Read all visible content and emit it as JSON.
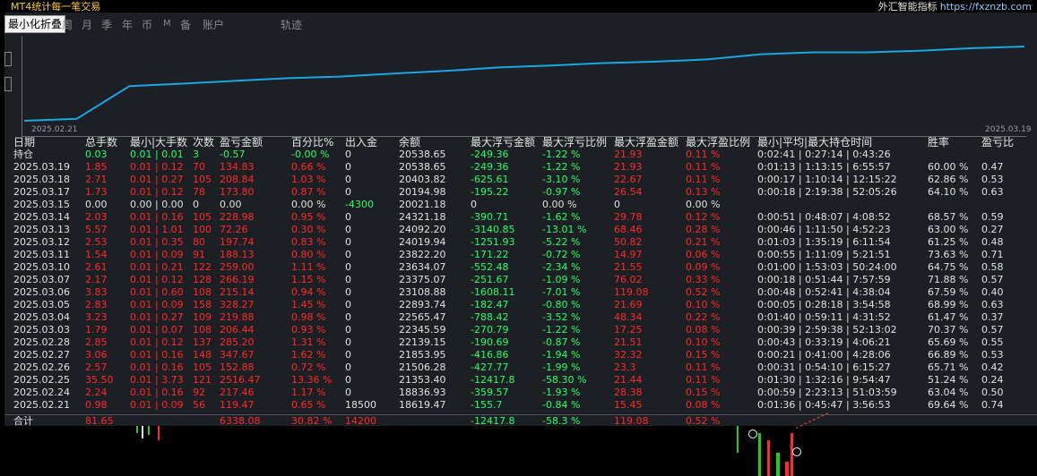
{
  "header": {
    "app_title": "MT4统计每一笔交易",
    "brand_text": "外汇智能指标",
    "brand_url": "https://fxznzb.com"
  },
  "tabs": {
    "minimize_label": "最小化折叠",
    "items": [
      "周",
      "月",
      "季",
      "年",
      "币",
      "M",
      "备",
      "账户",
      "轨迹"
    ]
  },
  "chart": {
    "start_date": "2025.02.21",
    "end_date": "2025.03.19",
    "line_color": "#1aa6e6"
  },
  "chart_data": {
    "type": "line",
    "x": [
      "2025.02.21",
      "2025.02.24",
      "2025.02.25",
      "2025.02.26",
      "2025.02.27",
      "2025.02.28",
      "2025.03.03",
      "2025.03.04",
      "2025.03.05",
      "2025.03.06",
      "2025.03.07",
      "2025.03.10",
      "2025.03.11",
      "2025.03.12",
      "2025.03.13",
      "2025.03.14",
      "2025.03.15",
      "2025.03.17",
      "2025.03.18",
      "2025.03.19"
    ],
    "values": [
      0.98,
      3.22,
      38.72,
      41.29,
      44.35,
      47.2,
      48.99,
      52.22,
      55.05,
      58.88,
      61.05,
      63.66,
      65.2,
      67.73,
      73.3,
      75.33,
      75.33,
      77.06,
      79.77,
      81.62
    ],
    "ylabel": "",
    "xlabel": ""
  },
  "table": {
    "headers": [
      "日期",
      "总手数",
      "最小|大手数",
      "次数",
      "盈亏金额",
      "百分比%",
      "出入金",
      "余额",
      "最大浮亏金额",
      "最大浮亏比例",
      "最大浮盈金额",
      "最大浮盈比例",
      "最小|平均|最大持仓时间",
      "胜率",
      "盈亏比"
    ],
    "holding": {
      "label": "持仓",
      "lots": "0.03",
      "minmax": "0.01 | 0.01",
      "count": "3",
      "pnl": "-0.57",
      "pct": "-0.00 %",
      "flow": "0",
      "balance": "20538.65",
      "max_dd": "-249.36",
      "max_dd_pct": "-1.22 %",
      "max_fp": "21.93",
      "max_fp_pct": "0.11 %",
      "times": "0:02:41 | 0:27:14 | 0:43:26",
      "winrate": "",
      "pf": ""
    },
    "rows": [
      {
        "date": "2025.03.19",
        "lots": "1.85",
        "minmax": "0.01 | 0.12",
        "count": "70",
        "pnl": "134.83",
        "pct": "0.66 %",
        "flow": "0",
        "balance": "20538.65",
        "max_dd": "-249.36",
        "max_dd_pct": "-1.22 %",
        "max_fp": "21.93",
        "max_fp_pct": "0.11 %",
        "times": "0:01:13 | 1:13:15 | 6:55:57",
        "winrate": "60.00 %",
        "pf": "0.47"
      },
      {
        "date": "2025.03.18",
        "lots": "2.71",
        "minmax": "0.01 | 0.27",
        "count": "105",
        "pnl": "208.84",
        "pct": "1.03 %",
        "flow": "0",
        "balance": "20403.82",
        "max_dd": "-625.61",
        "max_dd_pct": "-3.10 %",
        "max_fp": "22.67",
        "max_fp_pct": "0.11 %",
        "times": "0:00:17 | 1:10:14 | 12:15:22",
        "winrate": "62.86 %",
        "pf": "0.53"
      },
      {
        "date": "2025.03.17",
        "lots": "1.73",
        "minmax": "0.01 | 0.12",
        "count": "78",
        "pnl": "173.80",
        "pct": "0.87 %",
        "flow": "0",
        "balance": "20194.98",
        "max_dd": "-195.22",
        "max_dd_pct": "-0.97 %",
        "max_fp": "26.54",
        "max_fp_pct": "0.13 %",
        "times": "0:00:18 | 2:19:38 | 52:05:26",
        "winrate": "64.10 %",
        "pf": "0.63"
      },
      {
        "date": "2025.03.15",
        "lots": "0.00",
        "minmax": "0.00 | 0.00",
        "count": "0",
        "pnl": "0.00",
        "pct": "0.00 %",
        "flow": "-4300",
        "balance": "20021.18",
        "max_dd": "0",
        "max_dd_pct": "0.00 %",
        "max_fp": "0",
        "max_fp_pct": "0.00 %",
        "times": "",
        "winrate": "",
        "pf": "",
        "zero": true
      },
      {
        "date": "2025.03.14",
        "lots": "2.03",
        "minmax": "0.01 | 0.16",
        "count": "105",
        "pnl": "228.98",
        "pct": "0.95 %",
        "flow": "0",
        "balance": "24321.18",
        "max_dd": "-390.71",
        "max_dd_pct": "-1.62 %",
        "max_fp": "29.78",
        "max_fp_pct": "0.12 %",
        "times": "0:00:51 | 0:48:07 | 4:08:52",
        "winrate": "68.57 %",
        "pf": "0.59"
      },
      {
        "date": "2025.03.13",
        "lots": "5.57",
        "minmax": "0.01 | 1.01",
        "count": "100",
        "pnl": "72.26",
        "pct": "0.30 %",
        "flow": "0",
        "balance": "24092.20",
        "max_dd": "-3140.85",
        "max_dd_pct": "-13.01 %",
        "max_fp": "68.46",
        "max_fp_pct": "0.28 %",
        "times": "0:00:46 | 1:11:50 | 4:52:23",
        "winrate": "63.00 %",
        "pf": "0.27"
      },
      {
        "date": "2025.03.12",
        "lots": "2.53",
        "minmax": "0.01 | 0.35",
        "count": "80",
        "pnl": "197.74",
        "pct": "0.83 %",
        "flow": "0",
        "balance": "24019.94",
        "max_dd": "-1251.93",
        "max_dd_pct": "-5.22 %",
        "max_fp": "50.82",
        "max_fp_pct": "0.21 %",
        "times": "0:01:03 | 1:35:19 | 6:11:54",
        "winrate": "61.25 %",
        "pf": "0.48"
      },
      {
        "date": "2025.03.11",
        "lots": "1.54",
        "minmax": "0.01 | 0.09",
        "count": "91",
        "pnl": "188.13",
        "pct": "0.80 %",
        "flow": "0",
        "balance": "23822.20",
        "max_dd": "-171.22",
        "max_dd_pct": "-0.72 %",
        "max_fp": "14.97",
        "max_fp_pct": "0.06 %",
        "times": "0:00:55 | 1:11:09 | 5:21:51",
        "winrate": "73.63 %",
        "pf": "0.71"
      },
      {
        "date": "2025.03.10",
        "lots": "2.61",
        "minmax": "0.01 | 0.21",
        "count": "122",
        "pnl": "259.00",
        "pct": "1.11 %",
        "flow": "0",
        "balance": "23634.07",
        "max_dd": "-552.48",
        "max_dd_pct": "-2.34 %",
        "max_fp": "21.55",
        "max_fp_pct": "0.09 %",
        "times": "0:01:00 | 1:53:03 | 50:24:00",
        "winrate": "64.75 %",
        "pf": "0.58"
      },
      {
        "date": "2025.03.07",
        "lots": "2.17",
        "minmax": "0.01 | 0.12",
        "count": "128",
        "pnl": "266.19",
        "pct": "1.15 %",
        "flow": "0",
        "balance": "23375.07",
        "max_dd": "-251.67",
        "max_dd_pct": "-1.09 %",
        "max_fp": "76.02",
        "max_fp_pct": "0.33 %",
        "times": "0:00:18 | 0:51:44 | 7:57:59",
        "winrate": "71.88 %",
        "pf": "0.57"
      },
      {
        "date": "2025.03.06",
        "lots": "3.83",
        "minmax": "0.01 | 0.60",
        "count": "108",
        "pnl": "215.14",
        "pct": "0.94 %",
        "flow": "0",
        "balance": "23108.88",
        "max_dd": "-1608.11",
        "max_dd_pct": "-7.01 %",
        "max_fp": "119.08",
        "max_fp_pct": "0.52 %",
        "times": "0:00:48 | 0:52:41 | 4:38:04",
        "winrate": "67.59 %",
        "pf": "0.40"
      },
      {
        "date": "2025.03.05",
        "lots": "2.83",
        "minmax": "0.01 | 0.09",
        "count": "158",
        "pnl": "328.27",
        "pct": "1.45 %",
        "flow": "0",
        "balance": "22893.74",
        "max_dd": "-182.47",
        "max_dd_pct": "-0.80 %",
        "max_fp": "21.69",
        "max_fp_pct": "0.10 %",
        "times": "0:00:05 | 0:28:18 | 3:54:58",
        "winrate": "68.99 %",
        "pf": "0.63"
      },
      {
        "date": "2025.03.04",
        "lots": "3.23",
        "minmax": "0.01 | 0.27",
        "count": "109",
        "pnl": "219.88",
        "pct": "0.98 %",
        "flow": "0",
        "balance": "22565.47",
        "max_dd": "-788.42",
        "max_dd_pct": "-3.52 %",
        "max_fp": "48.34",
        "max_fp_pct": "0.22 %",
        "times": "0:01:40 | 0:59:11 | 4:31:52",
        "winrate": "61.47 %",
        "pf": "0.37"
      },
      {
        "date": "2025.03.03",
        "lots": "1.79",
        "minmax": "0.01 | 0.07",
        "count": "108",
        "pnl": "206.44",
        "pct": "0.93 %",
        "flow": "0",
        "balance": "22345.59",
        "max_dd": "-270.79",
        "max_dd_pct": "-1.22 %",
        "max_fp": "17.25",
        "max_fp_pct": "0.08 %",
        "times": "0:00:39 | 2:59:38 | 52:13:02",
        "winrate": "70.37 %",
        "pf": "0.57"
      },
      {
        "date": "2025.02.28",
        "lots": "2.85",
        "minmax": "0.01 | 0.12",
        "count": "137",
        "pnl": "285.20",
        "pct": "1.31 %",
        "flow": "0",
        "balance": "22139.15",
        "max_dd": "-190.69",
        "max_dd_pct": "-0.87 %",
        "max_fp": "21.51",
        "max_fp_pct": "0.10 %",
        "times": "0:00:43 | 0:33:19 | 4:06:21",
        "winrate": "65.69 %",
        "pf": "0.55"
      },
      {
        "date": "2025.02.27",
        "lots": "3.06",
        "minmax": "0.01 | 0.16",
        "count": "148",
        "pnl": "347.67",
        "pct": "1.62 %",
        "flow": "0",
        "balance": "21853.95",
        "max_dd": "-416.86",
        "max_dd_pct": "-1.94 %",
        "max_fp": "32.32",
        "max_fp_pct": "0.15 %",
        "times": "0:00:21 | 0:41:00 | 4:28:06",
        "winrate": "66.89 %",
        "pf": "0.53"
      },
      {
        "date": "2025.02.26",
        "lots": "2.57",
        "minmax": "0.01 | 0.16",
        "count": "105",
        "pnl": "152.88",
        "pct": "0.72 %",
        "flow": "0",
        "balance": "21506.28",
        "max_dd": "-427.77",
        "max_dd_pct": "-1.99 %",
        "max_fp": "23.3",
        "max_fp_pct": "0.11 %",
        "times": "0:00:31 | 0:54:10 | 6:15:27",
        "winrate": "65.71 %",
        "pf": "0.42"
      },
      {
        "date": "2025.02.25",
        "lots": "35.50",
        "minmax": "0.01 | 3.73",
        "count": "121",
        "pnl": "2516.47",
        "pct": "13.36 %",
        "flow": "0",
        "balance": "21353.40",
        "max_dd": "-12417.8",
        "max_dd_pct": "-58.30 %",
        "max_fp": "21.44",
        "max_fp_pct": "0.11 %",
        "times": "0:01:30 | 1:32:16 | 9:54:47",
        "winrate": "51.24 %",
        "pf": "0.24"
      },
      {
        "date": "2025.02.24",
        "lots": "2.24",
        "minmax": "0.01 | 0.16",
        "count": "92",
        "pnl": "217.46",
        "pct": "1.17 %",
        "flow": "0",
        "balance": "18836.93",
        "max_dd": "-359.57",
        "max_dd_pct": "-1.93 %",
        "max_fp": "28.38",
        "max_fp_pct": "0.15 %",
        "times": "0:00:59 | 2:23:13 | 51:03:59",
        "winrate": "63.04 %",
        "pf": "0.50"
      },
      {
        "date": "2025.02.21",
        "lots": "0.98",
        "minmax": "0.01 | 0.09",
        "count": "56",
        "pnl": "119.47",
        "pct": "0.65 %",
        "flow": "18500",
        "balance": "18619.47",
        "max_dd": "-155.7",
        "max_dd_pct": "-0.84 %",
        "max_fp": "15.45",
        "max_fp_pct": "0.08 %",
        "times": "0:01:36 | 0:45:47 | 3:56:53",
        "winrate": "69.64 %",
        "pf": "0.74"
      }
    ],
    "total": {
      "label": "合计",
      "lots": "81.65",
      "pnl": "6338.08",
      "pct": "30.82 %",
      "flow": "14200",
      "max_dd": "-12417.8",
      "max_dd_pct": "-58.3 %",
      "max_fp": "119.08",
      "max_fp_pct": "0.52 %"
    }
  }
}
